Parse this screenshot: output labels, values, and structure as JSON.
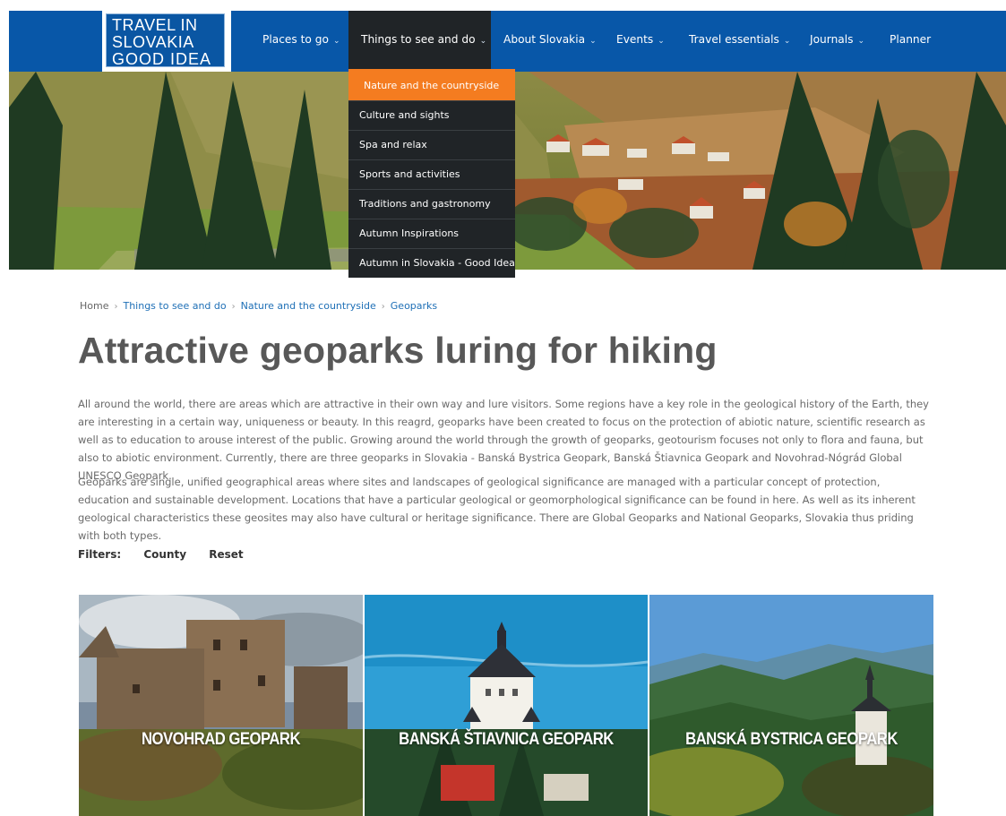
{
  "logo": {
    "line1": "TRAVEL IN",
    "line2": "SLOVAKIA",
    "line3": "GOOD IDEA"
  },
  "nav": [
    {
      "label": "Places to go",
      "chevron": "⌄"
    },
    {
      "label": "Things to see and do",
      "chevron": "⌄"
    },
    {
      "label": "About Slovakia",
      "chevron": "⌄"
    },
    {
      "label": "Events",
      "chevron": "⌄"
    },
    {
      "label": "Travel essentials",
      "chevron": "⌄"
    },
    {
      "label": "Journals",
      "chevron": "⌄"
    },
    {
      "label": "Planner",
      "chevron": ""
    }
  ],
  "dropdown": [
    "Nature and the countryside",
    "Culture and sights",
    "Spa and relax",
    "Sports and activities",
    "Traditions and gastronomy",
    "Autumn Inspirations",
    "Autumn in Slovakia - Good Idea"
  ],
  "breadcrumb": {
    "home": "Home",
    "level1": "Things to see and do",
    "level2": "Nature and the countryside",
    "current": "Geoparks",
    "separator": "›"
  },
  "title": "Attractive geoparks luring for hiking",
  "paragraphs": [
    "All around the world, there are areas which are attractive in their own way and lure visitors. Some regions have a key role in the geological history of the Earth, they are interesting in a certain way, uniqueness or beauty. In this reagrd, geoparks have been created to focus on the protection of abiotic nature, scientific research as well as to education to arouse interest of the public. Growing around the world through the growth of geoparks, geotourism focuses not only to flora and fauna, but also to abiotic environment. Currently, there are three geoparks in Slovakia - Banská Bystrica Geopark, Banská Štiavnica Geopark and Novohrad-Nógrád Global UNESCO Geopark.",
    "Geoparks are single, unified geographical areas where sites and landscapes of geological significance are managed with a particular concept of protection, education and sustainable development. Locations that have a particular geological or geomorphological significance can be found in here. As well as its inherent geological characteristics these geosites may also have cultural or heritage significance. There are Global Geoparks and National Geoparks, Slovakia thus priding with both types."
  ],
  "filters": {
    "label": "Filters:",
    "county": "County",
    "reset": "Reset"
  },
  "cards": [
    {
      "title": "NOVOHRAD GEOPARK"
    },
    {
      "title": "BANSKÁ ŠTIAVNICA GEOPARK"
    },
    {
      "title": "BANSKÁ BYSTRICA GEOPARK"
    }
  ],
  "colors": {
    "nav_bg": "#0857a8",
    "nav_active_bg": "#202427",
    "dropdown_highlight": "#f47c20",
    "link": "#1e6fb6",
    "title_text": "#585858",
    "body_text": "#6a6a6a"
  },
  "icons": {
    "nav_chevron": "chevron-down-icon",
    "breadcrumb_separator": "chevron-right-icon"
  }
}
